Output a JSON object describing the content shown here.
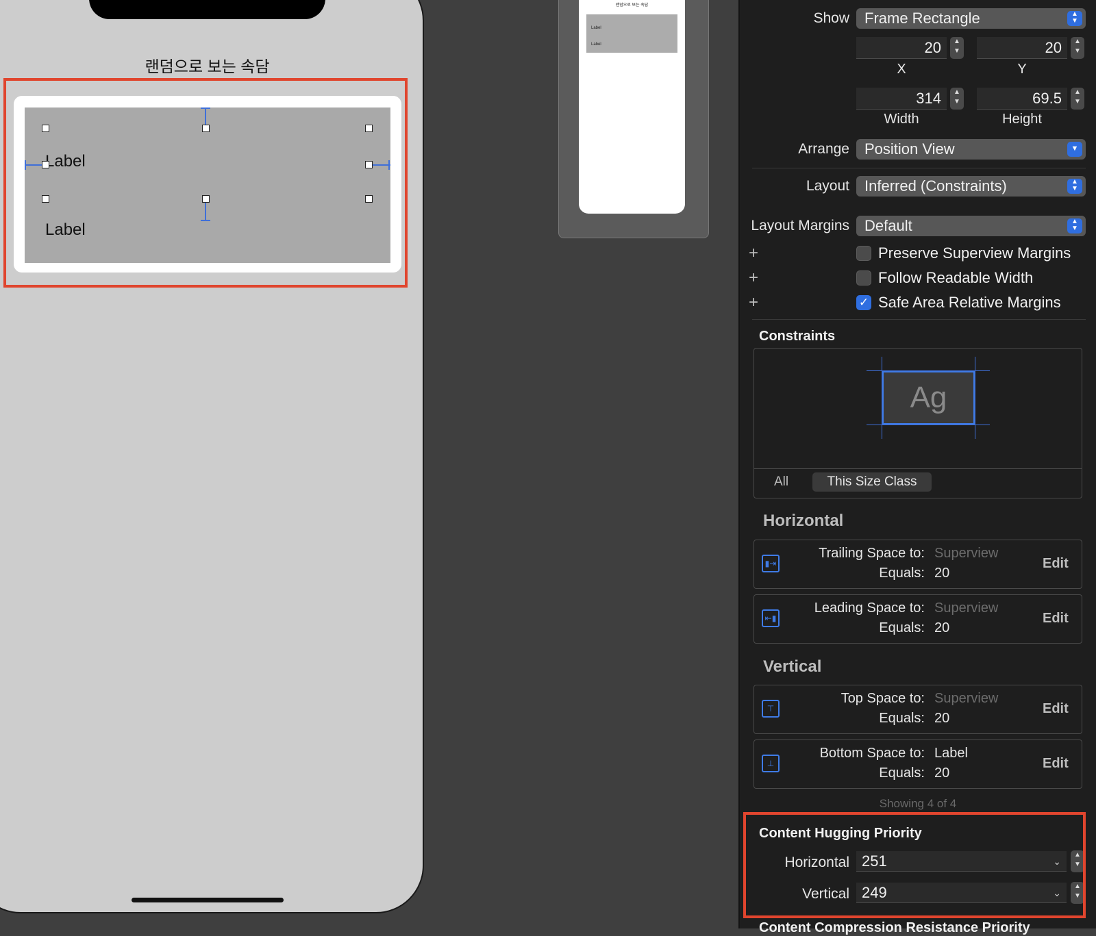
{
  "canvas": {
    "screen_title": "랜덤으로 보는 속담",
    "label_1": "Label",
    "label_2": "Label",
    "thumbnail_title": "랜덤으로 보는 속담",
    "thumbnail_label_1": "Label",
    "thumbnail_label_2": "Label"
  },
  "inspector": {
    "show_label": "Show",
    "show_value": "Frame Rectangle",
    "x_value": "20",
    "x_caption": "X",
    "y_value": "20",
    "y_caption": "Y",
    "width_value": "314",
    "width_caption": "Width",
    "height_value": "69.5",
    "height_caption": "Height",
    "arrange_label": "Arrange",
    "arrange_value": "Position View",
    "layout_label": "Layout",
    "layout_value": "Inferred (Constraints)",
    "margins_label": "Layout Margins",
    "margins_value": "Default",
    "checkboxes": [
      {
        "label": "Preserve Superview Margins",
        "checked": false
      },
      {
        "label": "Follow Readable Width",
        "checked": false
      },
      {
        "label": "Safe Area Relative Margins",
        "checked": true
      }
    ],
    "plus_symbol": "+",
    "constraints_title": "Constraints",
    "ag_text": "Ag",
    "tab_all": "All",
    "tab_size_class": "This Size Class",
    "horizontal_title": "Horizontal",
    "vertical_title": "Vertical",
    "equals_label": "Equals:",
    "edit_label": "Edit",
    "constraints": [
      {
        "name": "Trailing Space to:",
        "target": "Superview",
        "value": "20",
        "target_dim": true
      },
      {
        "name": "Leading Space to:",
        "target": "Superview",
        "value": "20",
        "target_dim": true
      },
      {
        "name": "Top Space to:",
        "target": "Superview",
        "value": "20",
        "target_dim": true
      },
      {
        "name": "Bottom Space to:",
        "target": "Label",
        "value": "20",
        "target_dim": false
      }
    ],
    "showing_text": "Showing 4 of 4",
    "hugging_title": "Content Hugging Priority",
    "hugging_horizontal_label": "Horizontal",
    "hugging_horizontal_value": "251",
    "hugging_vertical_label": "Vertical",
    "hugging_vertical_value": "249",
    "next_section_title": "Content Compression Resistance Priority"
  },
  "colors": {
    "accent": "#2f6ee0",
    "highlight": "#e0452e",
    "panel_bg": "#1e1e1e",
    "canvas_bg": "#3f3f3f"
  },
  "icons": {
    "popup": "chevron-updown-icon",
    "stepper": "stepper-icon",
    "trailing": "trailing-space-icon",
    "leading": "leading-space-icon",
    "top": "top-space-icon",
    "bottom": "bottom-space-icon"
  }
}
